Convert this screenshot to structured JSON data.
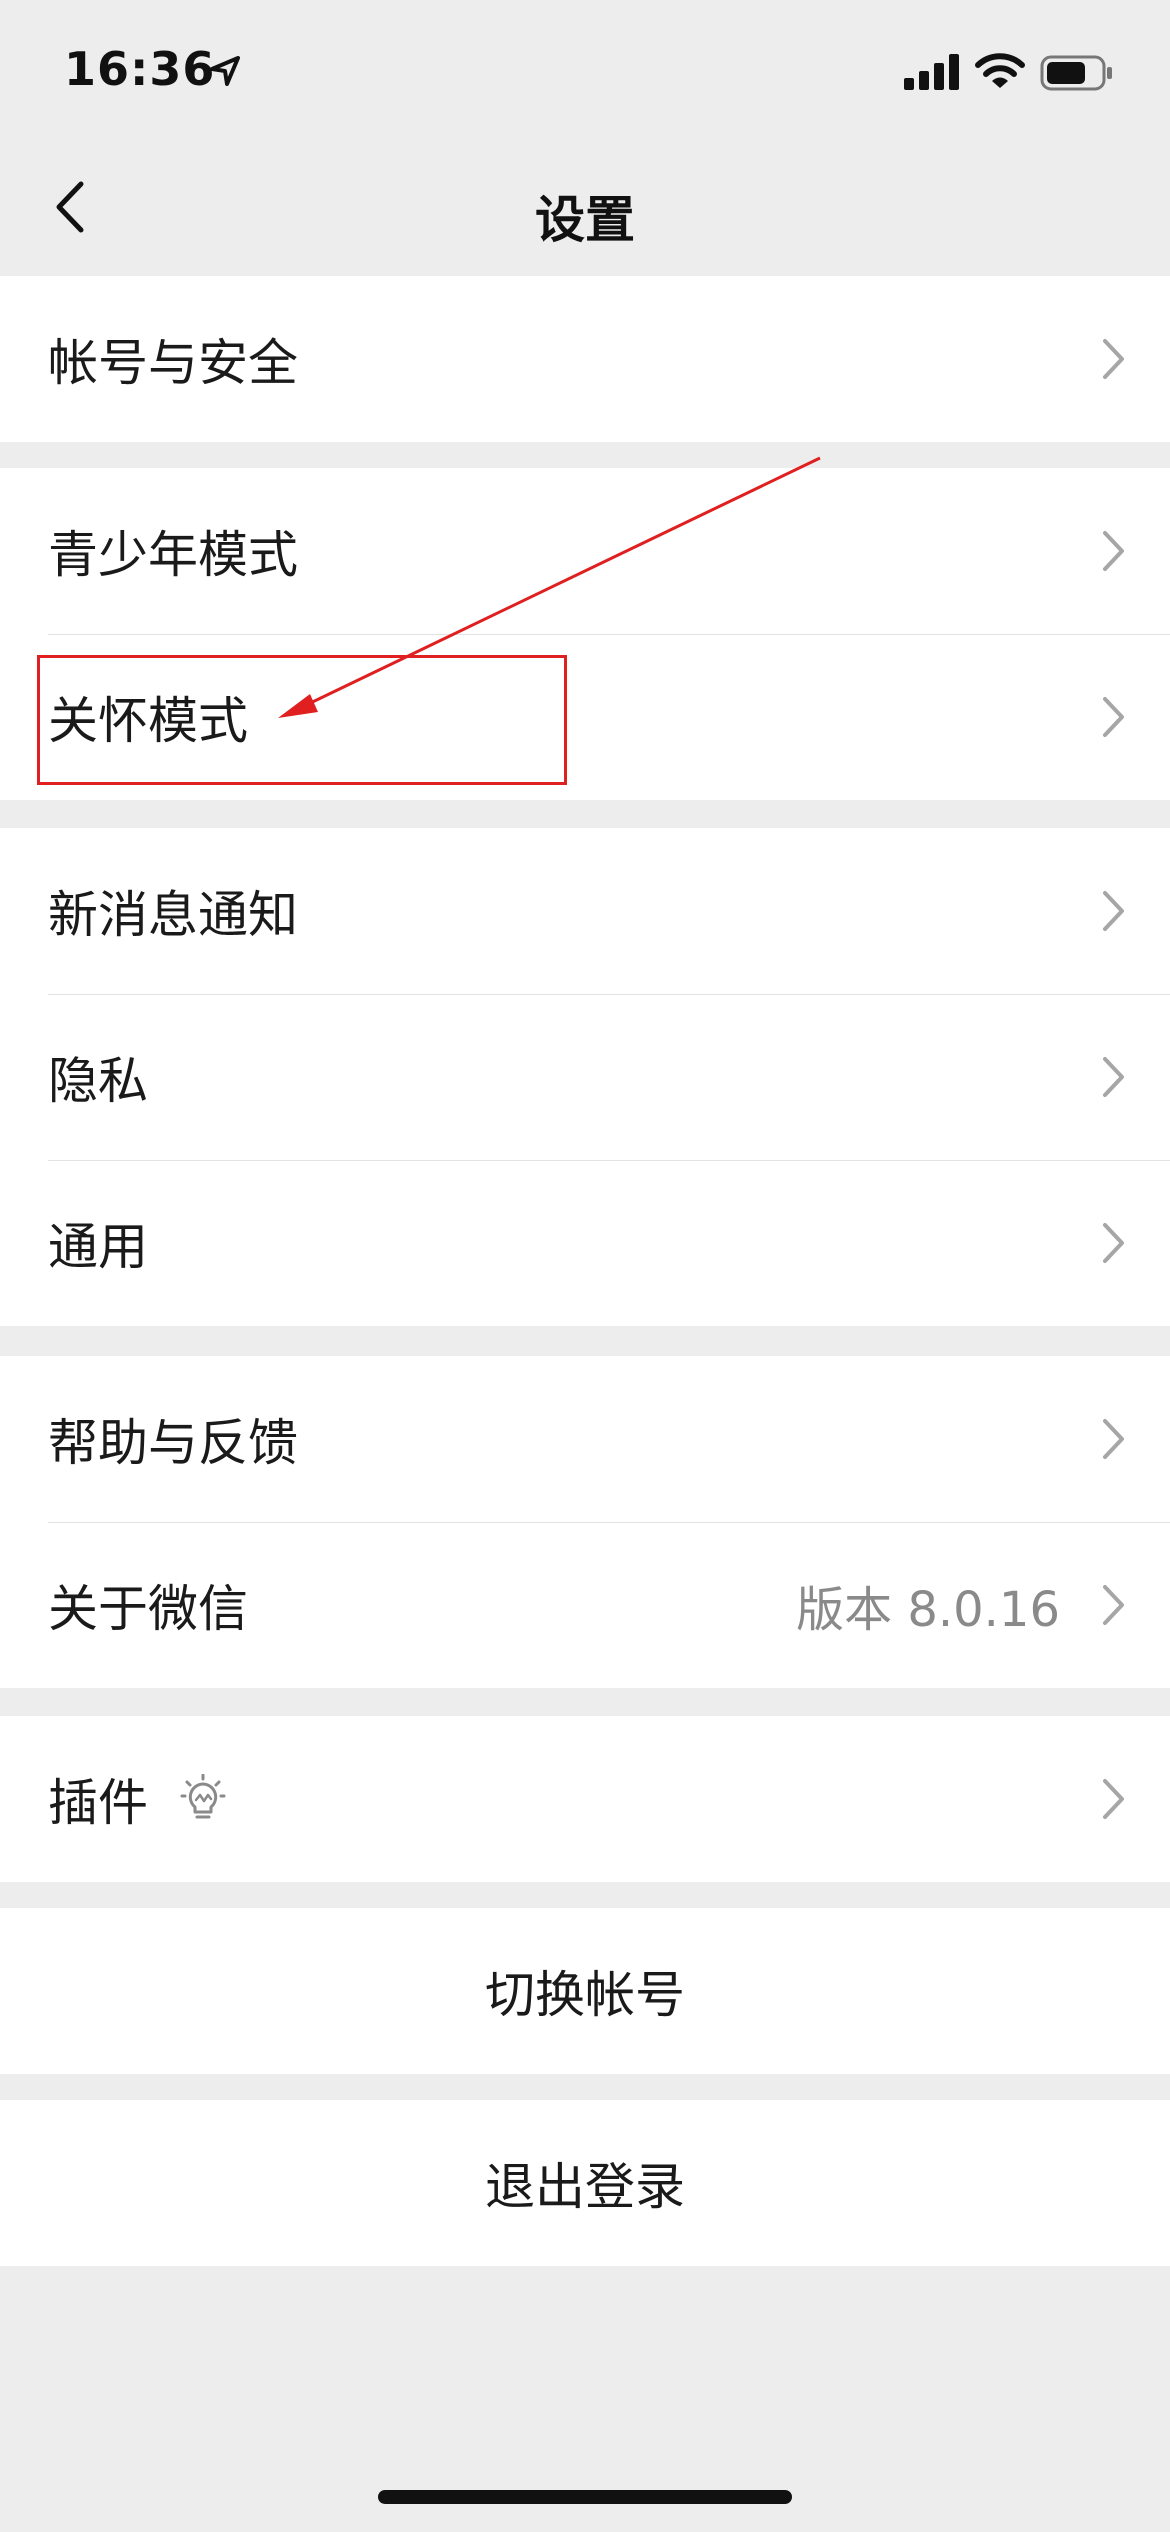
{
  "status_bar": {
    "time": "16:36"
  },
  "nav": {
    "title": "设置"
  },
  "groups": [
    {
      "items": [
        {
          "label": "帐号与安全"
        }
      ]
    },
    {
      "items": [
        {
          "label": "青少年模式"
        },
        {
          "label": "关怀模式"
        }
      ]
    },
    {
      "items": [
        {
          "label": "新消息通知"
        },
        {
          "label": "隐私"
        },
        {
          "label": "通用"
        }
      ]
    },
    {
      "items": [
        {
          "label": "帮助与反馈"
        },
        {
          "label": "关于微信",
          "value": "版本 8.0.16"
        }
      ]
    },
    {
      "items": [
        {
          "label": "插件",
          "icon": "lightbulb-icon"
        }
      ]
    }
  ],
  "actions": {
    "switch_account": "切换帐号",
    "logout": "退出登录"
  },
  "annotation": {
    "color": "#e02020",
    "highlighted_item": "关怀模式"
  }
}
